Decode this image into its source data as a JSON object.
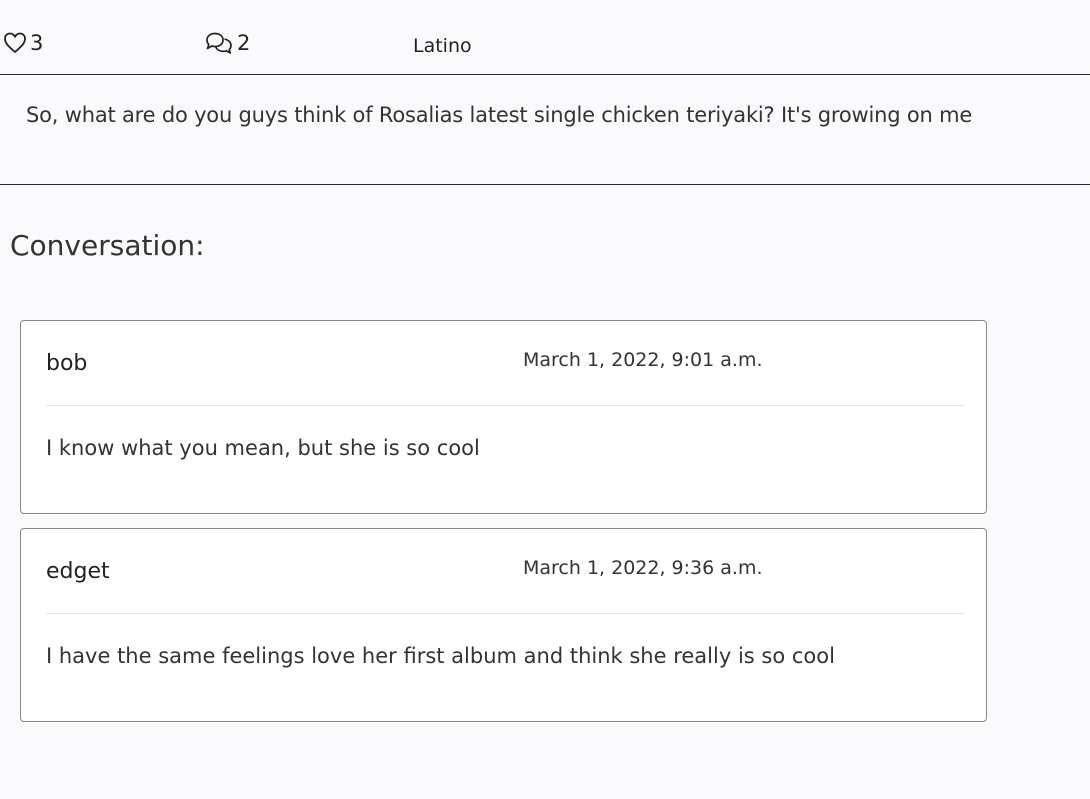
{
  "post": {
    "likes_count": "3",
    "comments_count": "2",
    "tag": "Latino",
    "text": "So, what are do you guys think of Rosalias latest single chicken teriyaki? It's growing on me"
  },
  "icons": {
    "likes": "heart-outline-icon",
    "comments": "chat-bubbles-icon"
  },
  "conversation": {
    "heading": "Conversation:",
    "comments": [
      {
        "author": "bob",
        "date": "March 1, 2022, 9:01 a.m.",
        "text": "I know what you mean, but she is so cool"
      },
      {
        "author": "edget",
        "date": "March 1, 2022, 9:36 a.m.",
        "text": "I have the same feelings love her first album and think she really is so cool"
      }
    ]
  }
}
